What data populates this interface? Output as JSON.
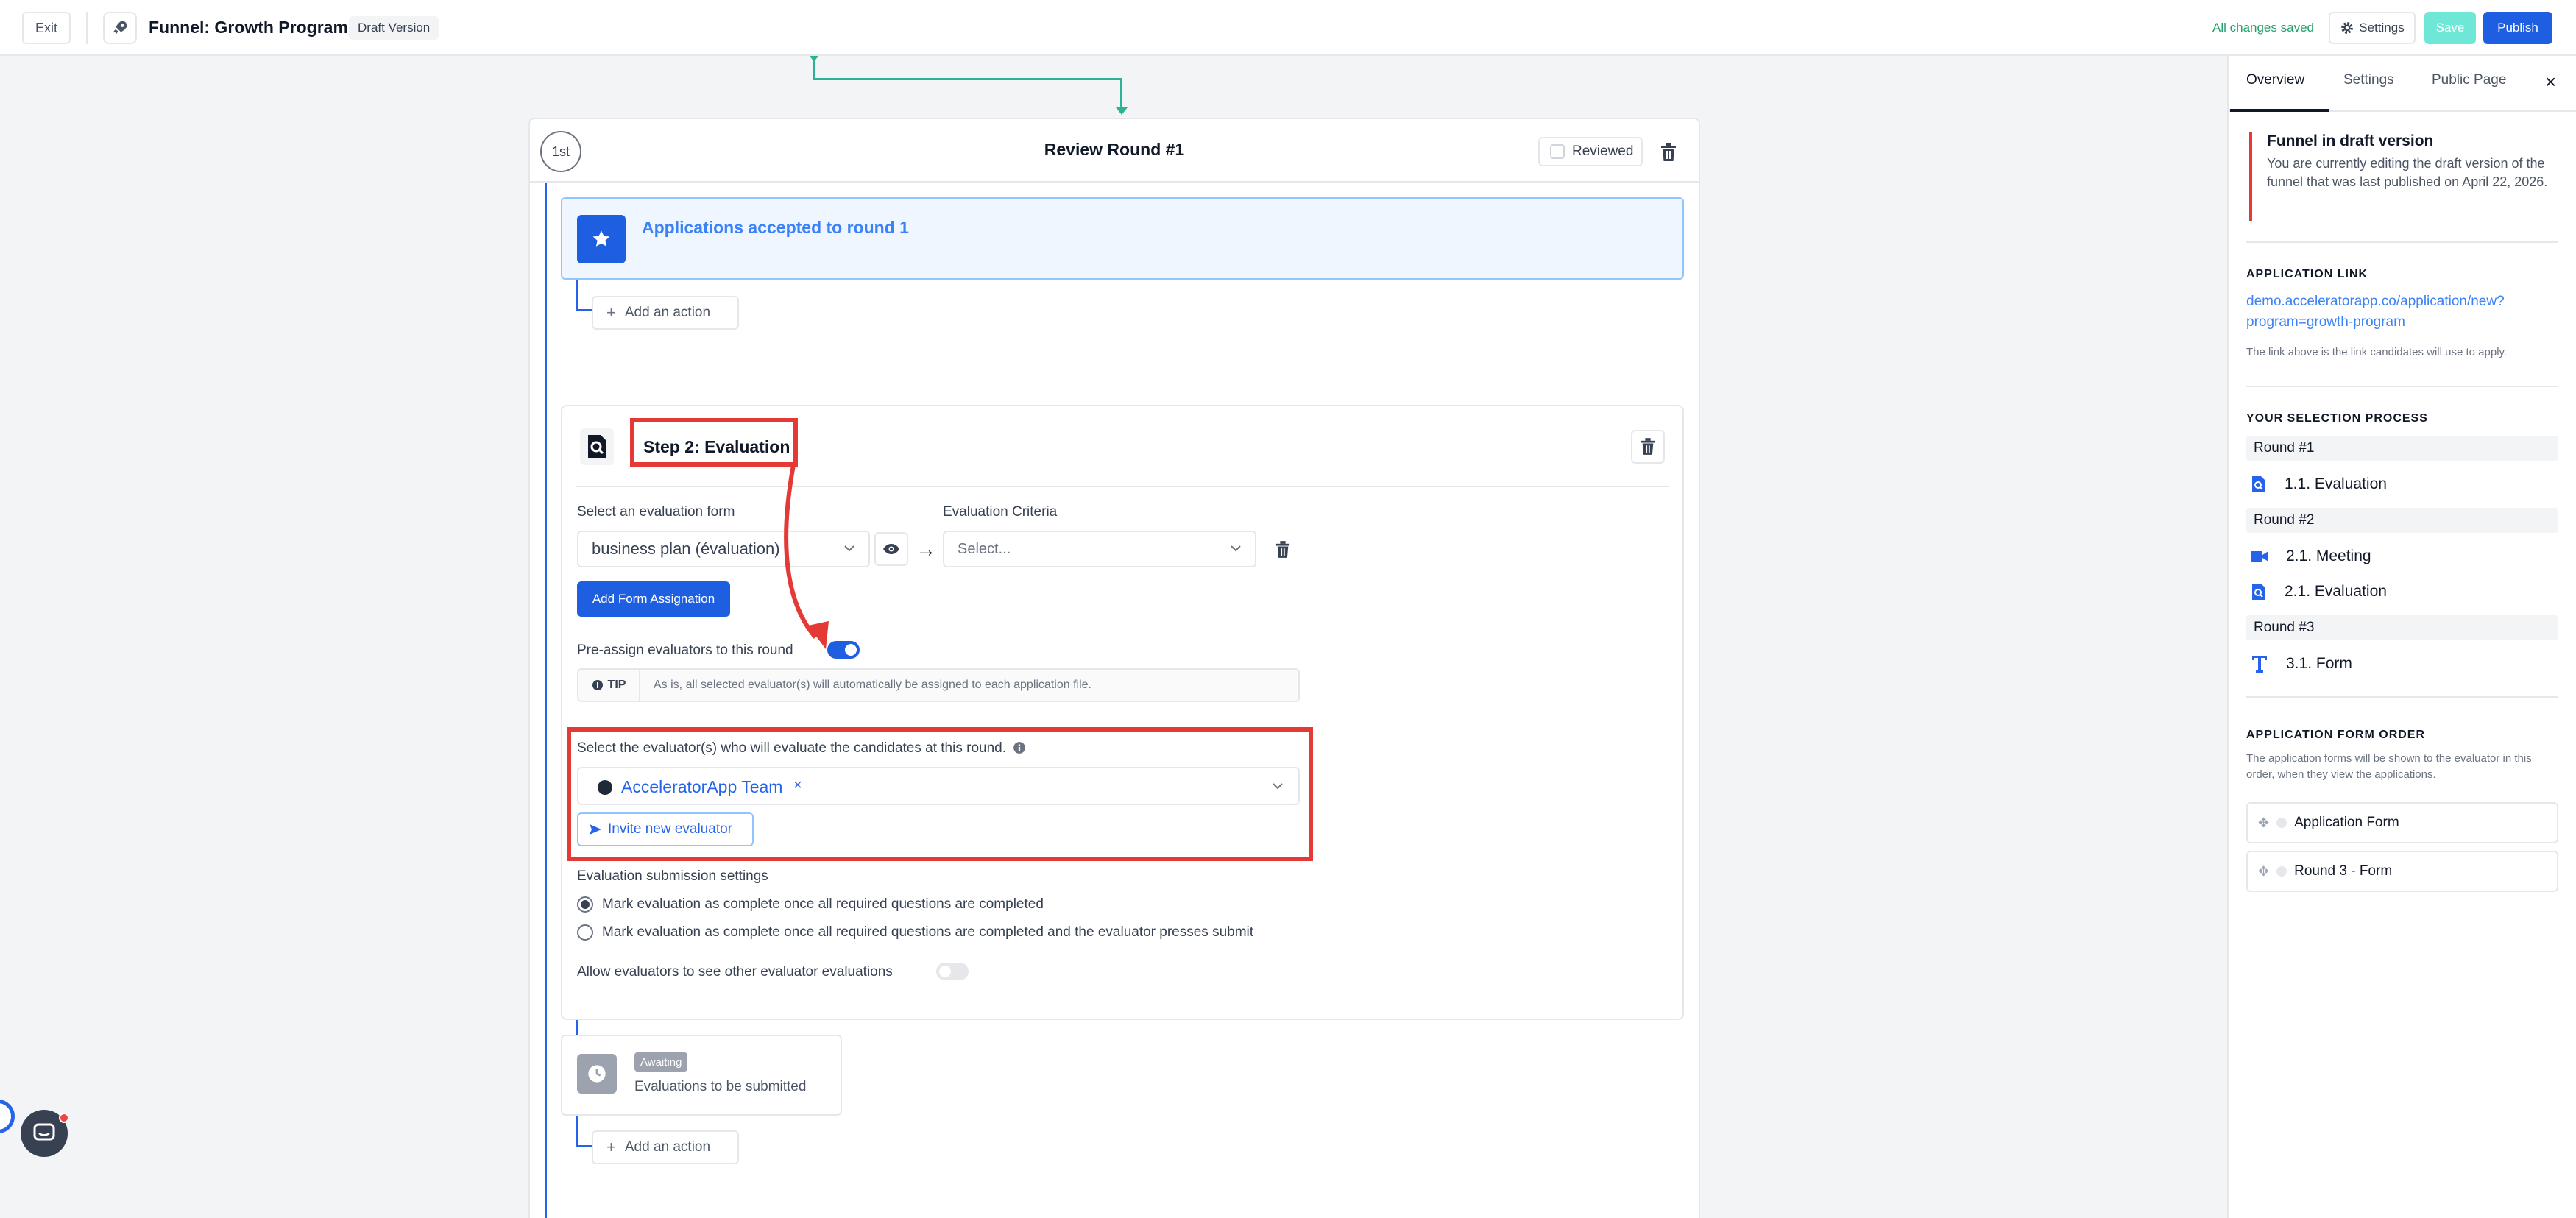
{
  "topbar": {
    "exit_label": "Exit",
    "funnel_title": "Funnel: Growth Program",
    "draft_badge": "Draft Version",
    "saved_status": "All changes saved",
    "settings_label": "Settings",
    "save_label": "Save",
    "publish_label": "Publish"
  },
  "round": {
    "number": "1st",
    "title": "Review Round #1",
    "reviewed_label": "Reviewed",
    "accepted_text": "Applications accepted to round 1",
    "add_action_label": "Add an action"
  },
  "step": {
    "title": "Step 2: Evaluation",
    "eval_form_label": "Select an evaluation form",
    "eval_form_value": "business plan (évaluation)",
    "criteria_label": "Evaluation Criteria",
    "criteria_placeholder": "Select...",
    "add_form_label": "Add Form Assignation",
    "preassign_label": "Pre-assign evaluators to this round",
    "preassign_on": true,
    "tip_label": "TIP",
    "tip_text": "As is, all selected evaluator(s) will automatically be assigned to each application file.",
    "evaluators_label": "Select the evaluator(s) who will evaluate the candidates at this round.",
    "selected_evaluator": "AcceleratorApp Team",
    "remove_symbol": "×",
    "invite_label": "Invite new evaluator",
    "submission_label": "Evaluation submission settings",
    "submission_options": [
      "Mark evaluation as complete once all required questions are completed",
      "Mark evaluation as complete once all required questions are completed and the evaluator presses submit"
    ],
    "selected_submission_option": 0,
    "allow_see_label": "Allow evaluators to see other evaluator evaluations",
    "allow_see_on": false
  },
  "awaiting": {
    "badge": "Awaiting",
    "text": "Evaluations to be submitted",
    "add_action_label": "Add an action"
  },
  "panel": {
    "tabs": [
      "Overview",
      "Settings",
      "Public Page"
    ],
    "active_tab": 0,
    "close_symbol": "×",
    "draft_title": "Funnel in draft version",
    "draft_text": "You are currently editing the draft version of the funnel that was last published on April 22, 2026.",
    "app_link_title": "APPLICATION LINK",
    "app_link_line1": "demo.acceleratorapp.co/application/new?",
    "app_link_line2": "program=growth-program",
    "app_link_note": "The link above is the link candidates will use to apply.",
    "process_title": "YOUR SELECTION PROCESS",
    "rounds": [
      {
        "label": "Round #1",
        "items": [
          {
            "icon": "evaluation-icon",
            "label": "1.1. Evaluation"
          }
        ]
      },
      {
        "label": "Round #2",
        "items": [
          {
            "icon": "video-icon",
            "label": "2.1. Meeting"
          },
          {
            "icon": "evaluation-icon",
            "label": "2.1. Evaluation"
          }
        ]
      },
      {
        "label": "Round #3",
        "items": [
          {
            "icon": "text-icon",
            "label": "3.1. Form"
          }
        ]
      }
    ],
    "order_title": "APPLICATION FORM ORDER",
    "order_note": "The application forms will be shown to the evaluator in this order, when they view the applications.",
    "order_items": [
      "Application Form",
      "Round 3 - Form"
    ]
  },
  "colors": {
    "primary": "#1d5fe0",
    "accent_green": "#2ab493",
    "highlight_red": "#e53935"
  }
}
